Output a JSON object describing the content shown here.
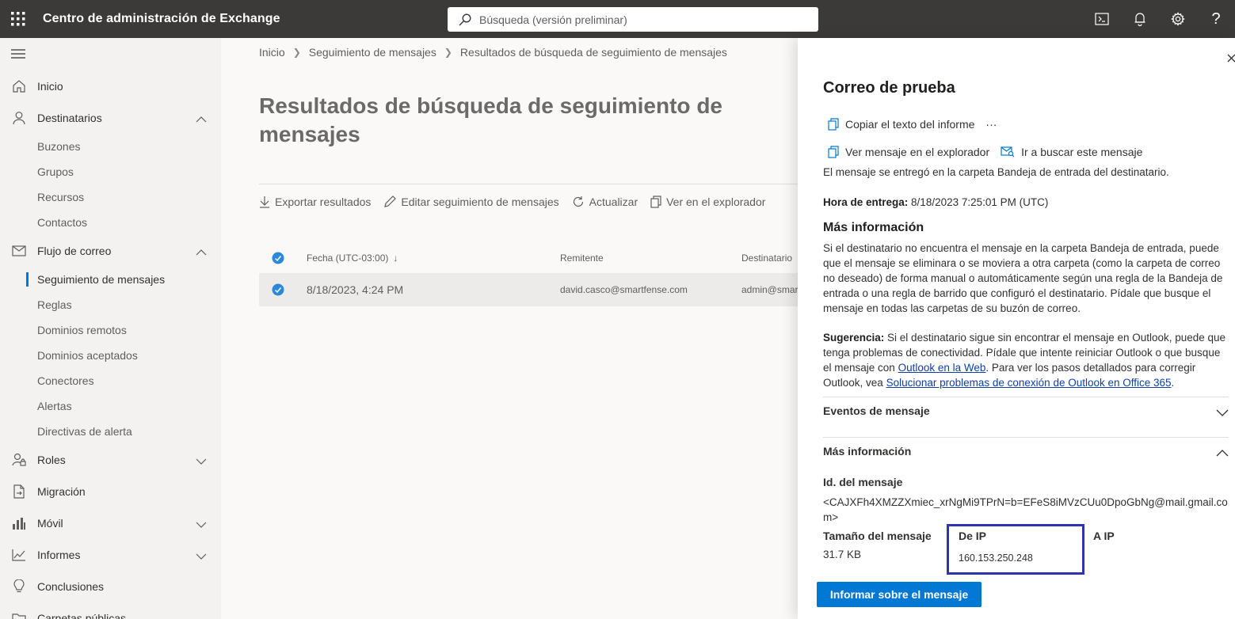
{
  "app": {
    "title": "Centro de administración de Exchange"
  },
  "search": {
    "placeholder": "Búsqueda (versión preliminar)"
  },
  "sidebar": {
    "items": [
      {
        "label": "Inicio"
      },
      {
        "label": "Destinatarios"
      },
      {
        "label": "Buzones"
      },
      {
        "label": "Grupos"
      },
      {
        "label": "Recursos"
      },
      {
        "label": "Contactos"
      },
      {
        "label": "Flujo de correo"
      },
      {
        "label": "Seguimiento de mensajes"
      },
      {
        "label": "Reglas"
      },
      {
        "label": "Dominios remotos"
      },
      {
        "label": "Dominios aceptados"
      },
      {
        "label": "Conectores"
      },
      {
        "label": "Alertas"
      },
      {
        "label": "Directivas de alerta"
      },
      {
        "label": "Roles"
      },
      {
        "label": "Migración"
      },
      {
        "label": "Móvil"
      },
      {
        "label": "Informes"
      },
      {
        "label": "Conclusiones"
      },
      {
        "label": "Carpetas públicas"
      }
    ]
  },
  "breadcrumb": [
    "Inicio",
    "Seguimiento de mensajes",
    "Resultados de búsqueda de seguimiento de mensajes"
  ],
  "page": {
    "title": "Resultados de búsqueda de seguimiento de mensajes"
  },
  "toolbar": {
    "export": "Exportar resultados",
    "edit": "Editar seguimiento de mensajes",
    "refresh": "Actualizar",
    "view": "Ver en el explorador"
  },
  "table": {
    "columns": [
      "Fecha (UTC-03:00)",
      "Remitente",
      "Destinatario"
    ],
    "sort_arrow": "↓",
    "rows": [
      {
        "date": "8/18/2023, 4:24 PM",
        "sender": "david.casco@smartfense.com",
        "recipient": "admin@smar"
      }
    ]
  },
  "panel": {
    "title": "Correo de prueba",
    "copy_report": "Copiar el texto del informe",
    "more": "···",
    "view_browser": "Ver mensaje en el explorador",
    "go_search": "Ir a buscar este mensaje",
    "delivered_text": "El mensaje se entregó en la carpeta Bandeja de entrada del destinatario.",
    "delivery_label": "Hora de entrega:",
    "delivery_value": "8/18/2023 7:25:01 PM (UTC)",
    "more_info_title": "Más información",
    "more_info_text": "Si el destinatario no encuentra el mensaje en la carpeta Bandeja de entrada, puede que el mensaje se eliminara o se moviera a otra carpeta (como la carpeta de correo no deseado) de forma manual o automáticamente según una regla de la Bandeja de entrada o una regla de barrido que configuró el destinatario. Pídale que busque el mensaje en todas las carpetas de su buzón de correo.",
    "tip_label": "Sugerencia:",
    "tip_text_1": "Si el destinatario sigue sin encontrar el mensaje en Outlook, puede que tenga problemas de conectividad. Pídale que intente reiniciar Outlook o que busque el mensaje con",
    "tip_link_1": "Outlook en la Web",
    "tip_text_2": ". Para ver los pasos detallados para corregir Outlook, vea",
    "tip_link_2": "Solucionar problemas de conexión de Outlook en Office 365",
    "tip_text_3": ".",
    "events_title": "Eventos de mensaje",
    "more_info_section": "Más información",
    "msg_id_label": "Id. del mensaje",
    "msg_id_value": "<CAJXFh4XMZZXmiec_xrNgMi9TPrN=b=EFeS8iMVzCUu0DpoGbNg@mail.gmail.com>",
    "size_label": "Tamaño del mensaje",
    "size_value": "31.7 KB",
    "from_ip_label": "De IP",
    "from_ip_value": "160.153.250.248",
    "to_ip_label": "A IP",
    "report_button": "Informar sobre el mensaje"
  },
  "colors": {
    "topbar": "#3b3a39",
    "accent": "#0078d4",
    "highlight": "#2e33b2"
  }
}
